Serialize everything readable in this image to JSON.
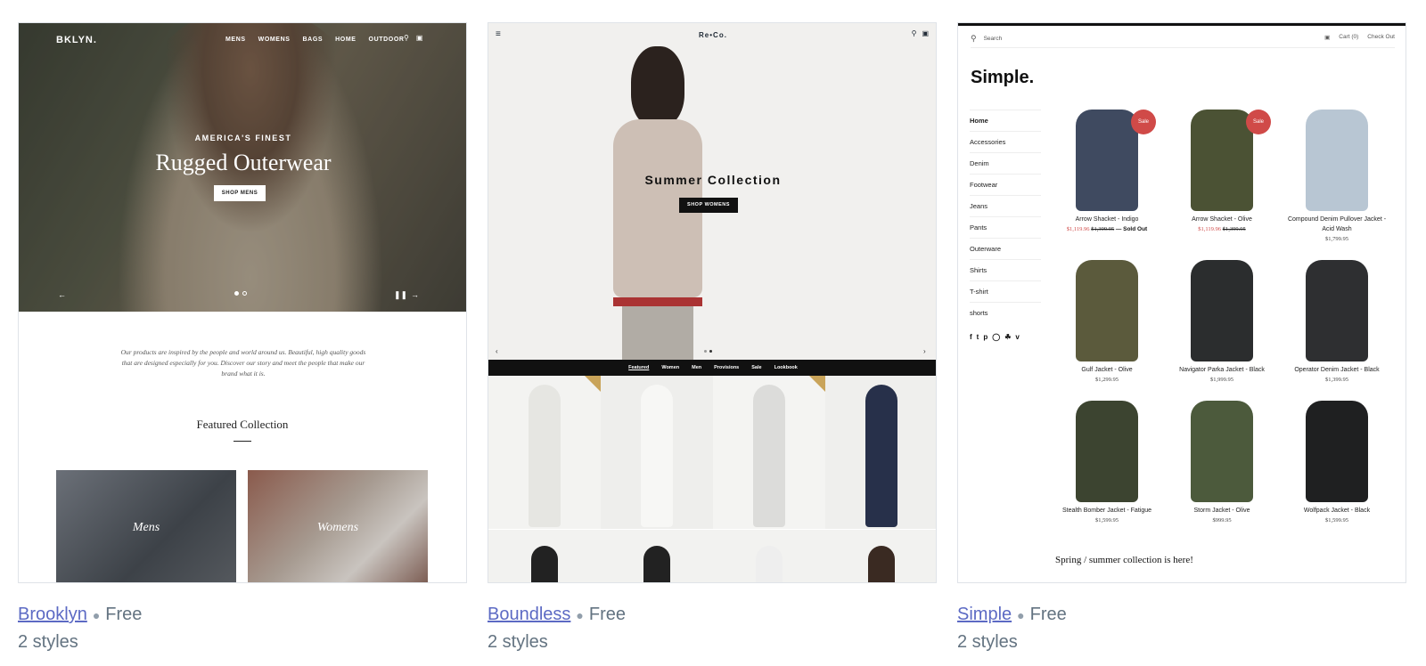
{
  "themes": [
    {
      "name": "Brooklyn",
      "price": "Free",
      "styles": "2 styles",
      "preview": {
        "logo": "BKLYN.",
        "nav": [
          "MENS",
          "WOMENS",
          "BAGS",
          "HOME",
          "OUTDOOR"
        ],
        "kicker": "AMERICA'S FINEST",
        "title": "Rugged Outerwear",
        "button": "SHOP MENS",
        "intro": "Our products are inspired by the people and world around us. Beautiful, high quality goods that are designed especially for you. Discover our story and meet the people that make our brand what it is.",
        "featured": "Featured Collection",
        "tiles": [
          "Mens",
          "Womens"
        ]
      }
    },
    {
      "name": "Boundless",
      "price": "Free",
      "styles": "2 styles",
      "preview": {
        "logo": "Re•Co.",
        "title": "Summer Collection",
        "button": "SHOP WOMENS",
        "tabs": [
          "Featured",
          "Women",
          "Men",
          "Provisions",
          "Sale",
          "Lookbook"
        ]
      }
    },
    {
      "name": "Simple",
      "price": "Free",
      "styles": "2 styles",
      "preview": {
        "search": "Search",
        "cart": "Cart (0)",
        "checkout": "Check Out",
        "logo": "Simple.",
        "categories": [
          "Home",
          "Accessories",
          "Denim",
          "Footwear",
          "Jeans",
          "Pants",
          "Outerware",
          "Shirts",
          "T-shirt",
          "shorts"
        ],
        "products": [
          {
            "name": "Arrow Shacket - Indigo",
            "sale_price": "$1,119.96",
            "old_price": "$1,399.95",
            "status": "— Sold Out",
            "sale": "Sale",
            "color": "#3f4a60"
          },
          {
            "name": "Arrow Shacket - Olive",
            "sale_price": "$1,119.96",
            "old_price": "$1,399.95",
            "sale": "Sale",
            "color": "#4b5234"
          },
          {
            "name": "Compound Denim Pullover Jacket - Acid Wash",
            "price": "$1,799.95",
            "color": "#b8c6d3"
          },
          {
            "name": "Gulf Jacket - Olive",
            "price": "$1,299.95",
            "color": "#5b5a3c"
          },
          {
            "name": "Navigator Parka Jacket - Black",
            "price": "$1,999.95",
            "color": "#2b2d2e"
          },
          {
            "name": "Operator Denim Jacket - Black",
            "price": "$1,399.95",
            "color": "#2e2f31"
          },
          {
            "name": "Stealth Bomber Jacket - Fatigue",
            "price": "$1,599.95",
            "color": "#3c4430"
          },
          {
            "name": "Storm Jacket - Olive",
            "price": "$999.95",
            "color": "#4c5a3c"
          },
          {
            "name": "Wolfpack Jacket - Black",
            "price": "$1,599.95",
            "color": "#1f2021"
          }
        ],
        "footer": "Spring / summer collection is here!"
      }
    }
  ],
  "link_color": "#5c6ac4"
}
